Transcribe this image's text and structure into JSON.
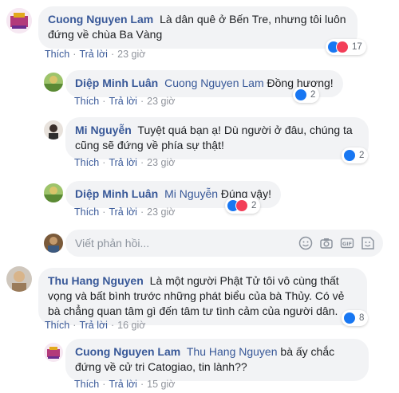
{
  "actions": {
    "like": "Thích",
    "reply": "Trả lời"
  },
  "comments": [
    {
      "author": "Cuong Nguyen Lam",
      "text": "Là dân quê ở Bến Tre, nhưng tôi luôn đứng về chùa Ba Vàng",
      "time": "23 giờ",
      "reactions": "17"
    },
    {
      "author": "Diệp Minh Luân",
      "mention": "Cuong Nguyen Lam",
      "text": "Đồng hương!",
      "time": "23 giờ",
      "reactions": "2"
    },
    {
      "author": "Mi Nguyễn",
      "text": "Tuyệt quá bạn ạ! Dù người ở đâu, chúng ta cũng sẽ đứng về phía sự thật!",
      "time": "23 giờ",
      "reactions": "2"
    },
    {
      "author": "Diệp Minh Luân",
      "mention": "Mi Nguyễn",
      "text": "Đúng vậy!",
      "time": "23 giờ",
      "reactions": "2"
    },
    {
      "author": "Thu Hang Nguyen",
      "text": "Là một người Phật Tử tôi vô cùng thất vọng và bất bình trước những phát biểu của bà Thủy. Có vẻ bà chẳng quan tâm gì đến tâm tư tình cảm của người dân.",
      "time": "16 giờ",
      "reactions": "8"
    },
    {
      "author": "Cuong Nguyen Lam",
      "mention": "Thu Hang Nguyen",
      "text": "bà ấy chắc đứng về cử tri Catogiao, tin lành??",
      "time": "15 giờ"
    }
  ],
  "reply_box": {
    "placeholder": "Viết phản hồi..."
  },
  "colors": {
    "link": "#385898",
    "bubble": "#f2f3f5",
    "like": "#1877f2",
    "love": "#f33e58"
  }
}
